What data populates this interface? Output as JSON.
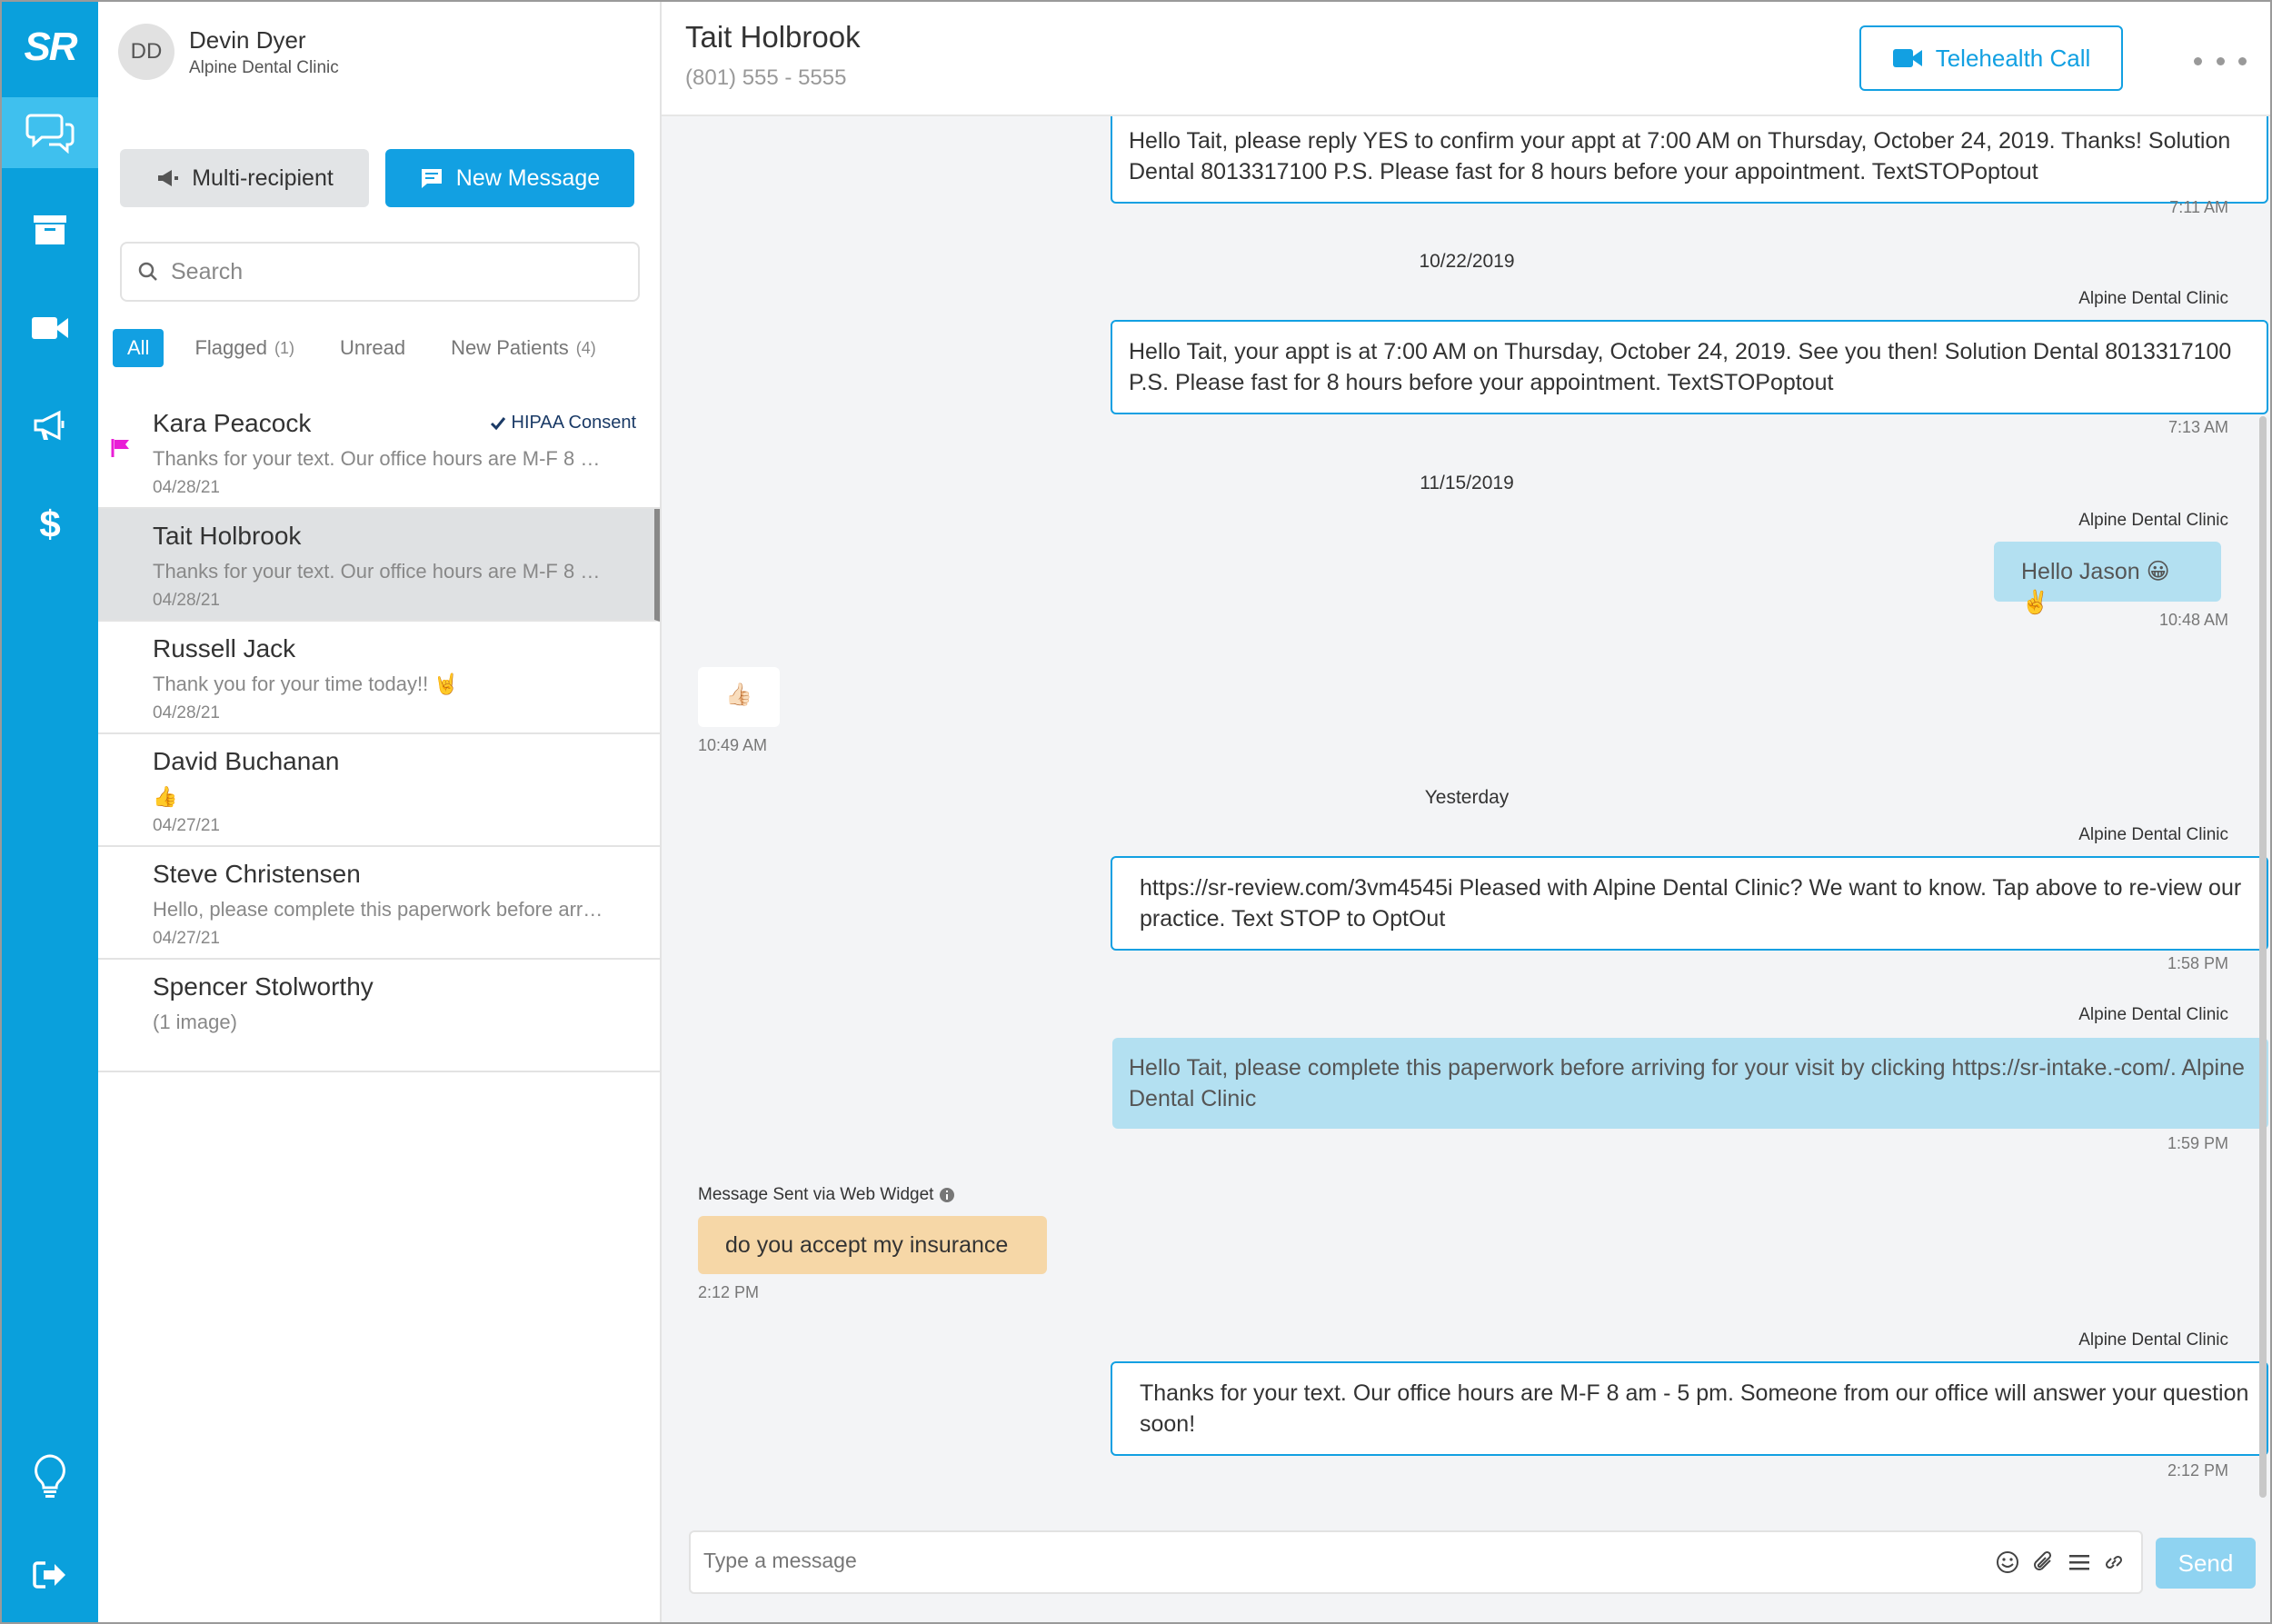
{
  "app": {
    "logo": "SR"
  },
  "user": {
    "initials": "DD",
    "name": "Devin Dyer",
    "org": "Alpine Dental Clinic"
  },
  "buttons": {
    "multi": "Multi-recipient",
    "new_message": "New Message"
  },
  "search": {
    "placeholder": "Search"
  },
  "filters": [
    {
      "label": "All",
      "count": ""
    },
    {
      "label": "Flagged",
      "count": "(1)"
    },
    {
      "label": "Unread",
      "count": ""
    },
    {
      "label": "New Patients",
      "count": "(4)"
    }
  ],
  "conversations": [
    {
      "name": "Kara Peacock",
      "preview": "Thanks for your text. Our office hours are M-F 8 …",
      "date": "04/28/21",
      "badge": "HIPAA Consent"
    },
    {
      "name": "Tait Holbrook",
      "preview": "Thanks for your text. Our office hours are M-F 8 …",
      "date": "04/28/21"
    },
    {
      "name": "Russell Jack",
      "preview": "Thank you for your time today!! 🤘",
      "date": "04/28/21"
    },
    {
      "name": "David Buchanan",
      "preview": "👍",
      "date": "04/27/21"
    },
    {
      "name": "Steve Christensen",
      "preview": "Hello, please complete this paperwork before arr…",
      "date": "04/27/21"
    },
    {
      "name": "Spencer Stolworthy",
      "preview": "(1 image)",
      "date": ""
    }
  ],
  "chat": {
    "title": "Tait Holbrook",
    "phone": "(801) 555 - 5555",
    "telehealth_label": "Telehealth Call",
    "sender_label": "Alpine Dental Clinic",
    "messages": [
      {
        "text": "Hello Tait, please reply YES to confirm your appt at 7:00 AM on Thursday, October 24, 2019. Thanks! Solution Dental 8013317100 P.S. Please fast for 8 hours before your appointment. TextSTOPoptout",
        "time": "7:11 AM"
      },
      {
        "day": "10/22/2019"
      },
      {
        "text": "Hello Tait, your appt is at 7:00 AM on Thursday, October 24, 2019. See you then! Solution Dental 8013317100 P.S. Please fast for 8 hours before your appointment. TextSTOPoptout",
        "time": "7:13 AM"
      },
      {
        "day": "11/15/2019"
      },
      {
        "text": "Hello Jason 😀✌️",
        "time": "10:48 AM"
      },
      {
        "text": "👍🏻",
        "time": "10:49 AM"
      },
      {
        "day": "Yesterday"
      },
      {
        "text": "https://sr-review.com/3vm4545i Pleased with Alpine Dental Clinic? We want to know. Tap above to re-view our practice. Text STOP to OptOut",
        "time": "1:58 PM"
      },
      {
        "text": "Hello Tait, please complete this paperwork before arriving for your visit by clicking https://sr-intake.-com/. Alpine Dental Clinic",
        "time": "1:59 PM"
      },
      {
        "via": "Message Sent via Web Widget",
        "text": "do you accept my insurance",
        "time": "2:12 PM"
      },
      {
        "text": "Thanks for your text. Our office hours are M-F 8 am - 5 pm. Someone from our office will answer your question soon!",
        "time": "2:12 PM"
      }
    ]
  },
  "composer": {
    "placeholder": "Type a message",
    "send_label": "Send"
  },
  "colors": {
    "nav": "#0aa0dc",
    "accent": "#12a0e2",
    "selected_nav": "#3fc0ee",
    "flag": "#e91ed6"
  }
}
